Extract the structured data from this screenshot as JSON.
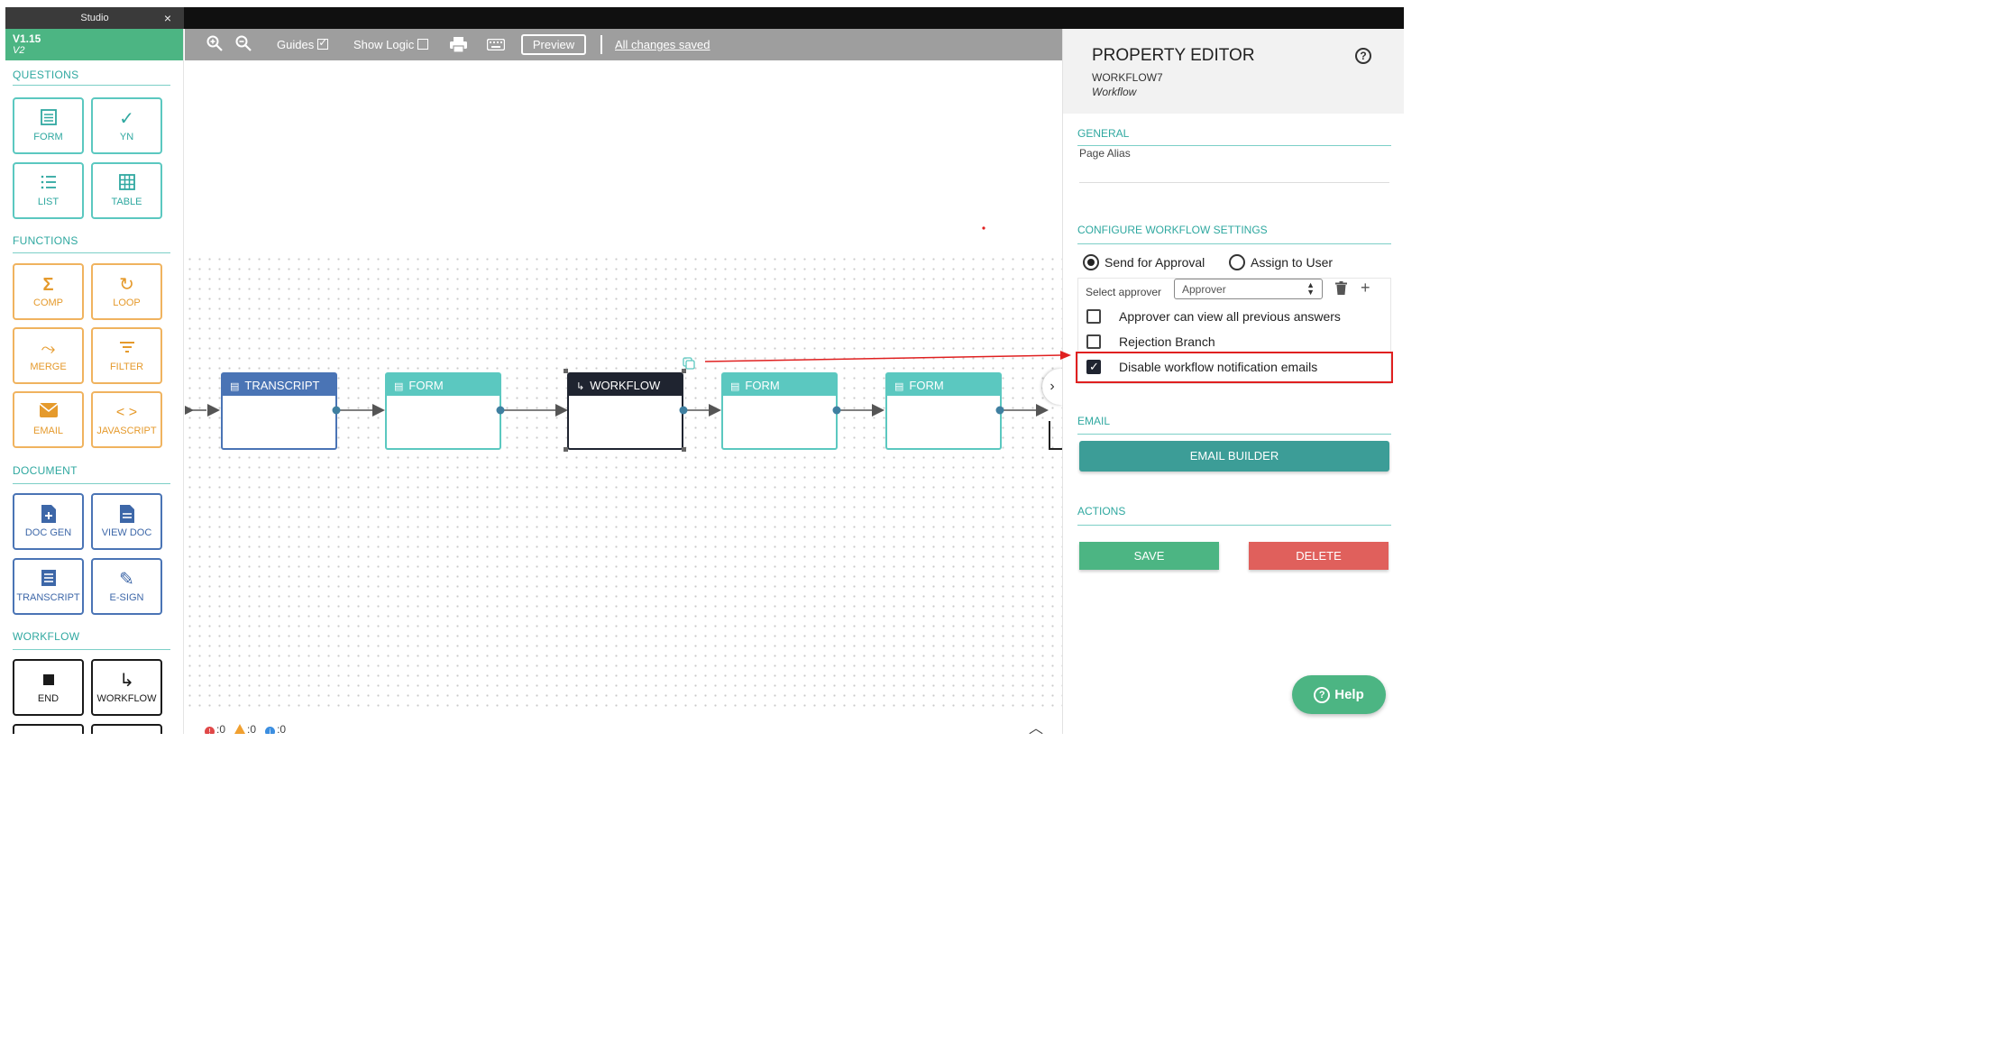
{
  "window": {
    "title": "Studio",
    "close": "×"
  },
  "version": {
    "primary": "V1.15",
    "secondary": "V2"
  },
  "palette": {
    "questions": {
      "title": "QUESTIONS",
      "items": [
        {
          "label": "FORM",
          "icon": "form-icon"
        },
        {
          "label": "YN",
          "icon": "check-icon"
        },
        {
          "label": "LIST",
          "icon": "list-icon"
        },
        {
          "label": "TABLE",
          "icon": "table-icon"
        }
      ]
    },
    "functions": {
      "title": "FUNCTIONS",
      "items": [
        {
          "label": "COMP",
          "icon": "sigma-icon"
        },
        {
          "label": "LOOP",
          "icon": "loop-icon"
        },
        {
          "label": "MERGE",
          "icon": "merge-icon"
        },
        {
          "label": "FILTER",
          "icon": "filter-icon"
        },
        {
          "label": "EMAIL",
          "icon": "envelope-icon"
        },
        {
          "label": "JAVASCRIPT",
          "icon": "code-icon"
        }
      ]
    },
    "document": {
      "title": "DOCUMENT",
      "items": [
        {
          "label": "DOC GEN",
          "icon": "doc-add-icon"
        },
        {
          "label": "VIEW DOC",
          "icon": "doc-icon"
        },
        {
          "label": "TRANSCRIPT",
          "icon": "transcript-icon"
        },
        {
          "label": "E-SIGN",
          "icon": "pen-icon"
        }
      ]
    },
    "workflow": {
      "title": "WORKFLOW",
      "items": [
        {
          "label": "END",
          "icon": "stop-icon"
        },
        {
          "label": "WORKFLOW",
          "icon": "workflow-arrow-icon"
        }
      ]
    }
  },
  "toolbar": {
    "guides_label": "Guides",
    "guides_checked": true,
    "show_logic_label": "Show Logic",
    "show_logic_checked": false,
    "preview_label": "Preview",
    "saved_status": "All changes saved"
  },
  "flow": {
    "nodes": [
      {
        "label": "TRANSCRIPT",
        "style": "blue"
      },
      {
        "label": "FORM",
        "style": "teal"
      },
      {
        "label": "WORKFLOW",
        "style": "dark",
        "selected": true
      },
      {
        "label": "FORM",
        "style": "teal"
      },
      {
        "label": "FORM",
        "style": "teal"
      }
    ]
  },
  "status_bar": {
    "errors": ":0",
    "warnings": ":0",
    "info": ":0"
  },
  "editor": {
    "title": "PROPERTY EDITOR",
    "node_name": "WORKFLOW7",
    "node_type": "Workflow",
    "general": {
      "title": "GENERAL",
      "page_alias_label": "Page Alias"
    },
    "configure": {
      "title": "CONFIGURE WORKFLOW SETTINGS",
      "radio_send": "Send for Approval",
      "radio_assign": "Assign to User",
      "selected_mode": "send",
      "select_approver_label": "Select approver",
      "approver_value": "Approver",
      "options": [
        {
          "label": "Approver can view all previous answers",
          "checked": false
        },
        {
          "label": "Rejection Branch",
          "checked": false
        },
        {
          "label": "Disable workflow notification emails",
          "checked": true
        }
      ]
    },
    "email": {
      "title": "EMAIL",
      "builder_label": "EMAIL BUILDER"
    },
    "actions": {
      "title": "ACTIONS",
      "save_label": "SAVE",
      "delete_label": "DELETE"
    },
    "help_label": "Help"
  },
  "colors": {
    "accent_green": "#4cb583",
    "teal": "#5bc8c0",
    "orange": "#f0b35f",
    "blue": "#4a74b5",
    "highlight_red": "#e02020"
  }
}
